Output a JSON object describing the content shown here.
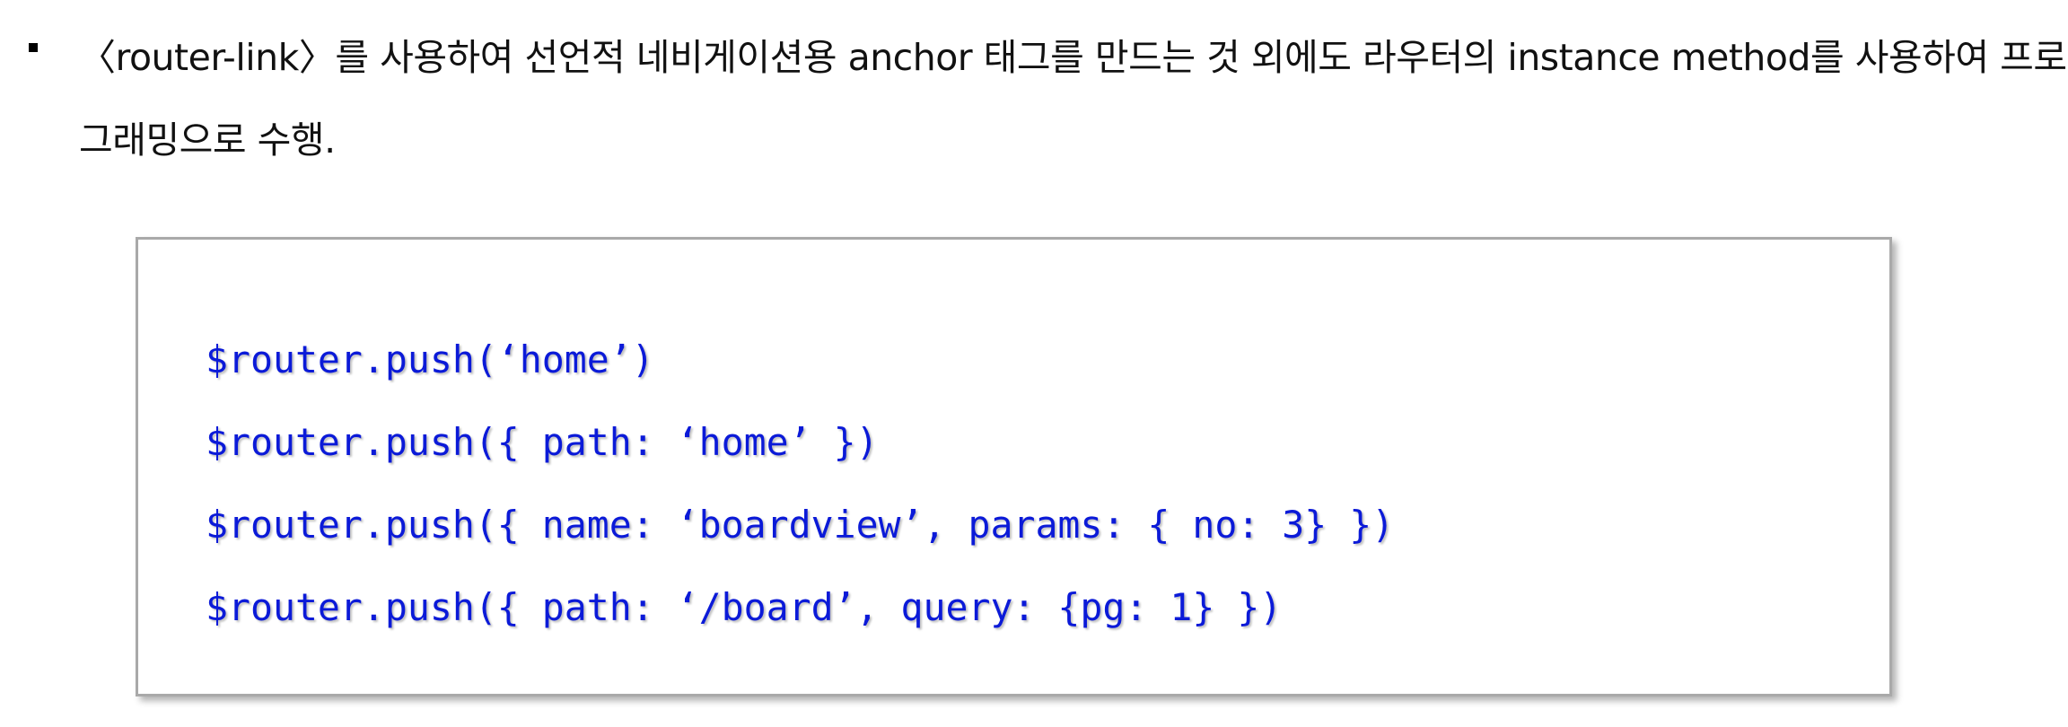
{
  "paragraph": {
    "bullet_icon": "square-bullet-icon",
    "text": "〈router-link〉를 사용하여 선언적 네비게이션용 anchor 태그를 만드는 것 외에도 라우터의 instance method를 사용하여 프로그래밍으로 수행."
  },
  "code_block": {
    "text_color": "#0b1ad8",
    "border_color": "#a9a9a9",
    "lines": [
      "$router.push(‘home’)",
      "$router.push({ path: ‘home’ })",
      "$router.push({ name: ‘boardview’, params: { no: 3} })",
      "$router.push({ path: ‘/board’, query: {pg: 1} })"
    ]
  }
}
